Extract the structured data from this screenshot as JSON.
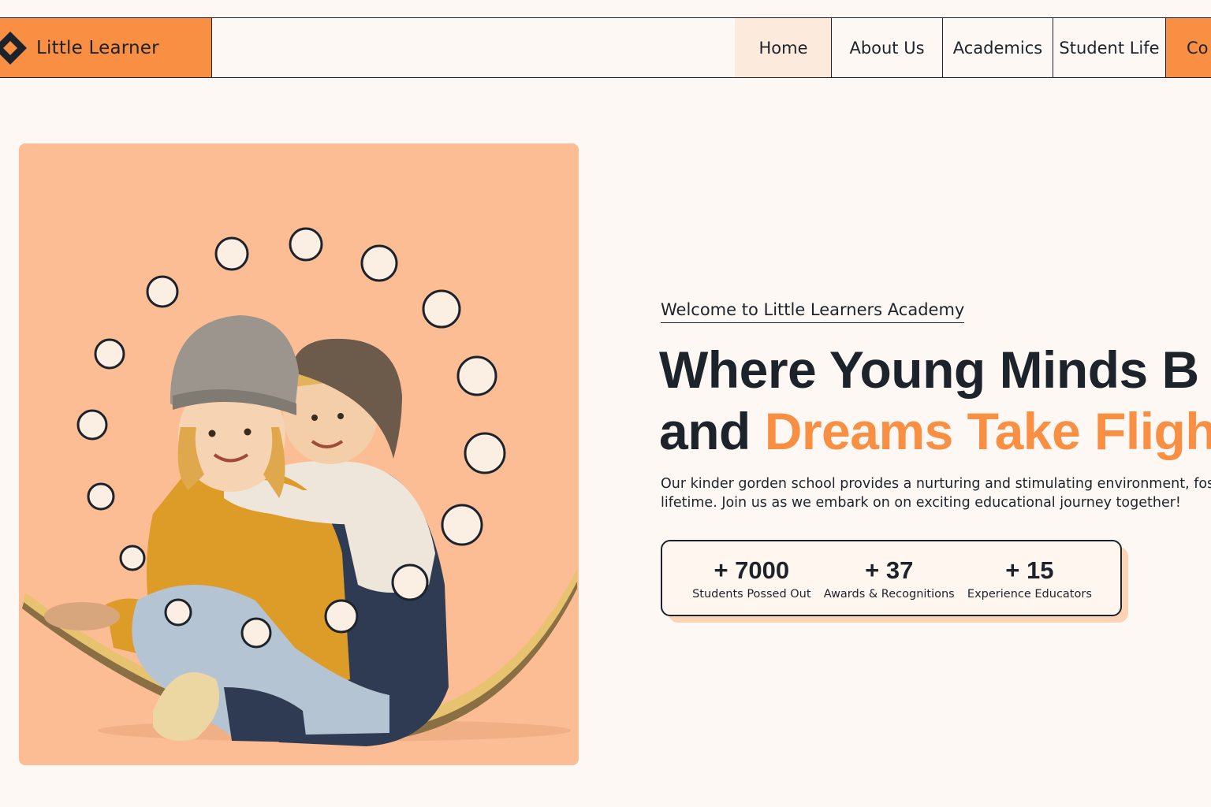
{
  "brand": {
    "name": "Little Learner",
    "logo_icon": "diamond-logo-icon",
    "accent_color": "#f98f42",
    "dark_color": "#1d232b",
    "background_color": "#fdf8f3"
  },
  "nav": {
    "items": [
      {
        "label": "Home",
        "active": true
      },
      {
        "label": "About Us",
        "active": false
      },
      {
        "label": "Academics",
        "active": false
      },
      {
        "label": "Student Life",
        "active": false
      }
    ],
    "cta_label": "Co"
  },
  "hero": {
    "eyebrow": "Welcome to Little Learners Academy",
    "headline_line1": "Where Young Minds B",
    "headline_line2_plain": "and ",
    "headline_line2_accent": "Dreams Take Fligh",
    "description_line1": "Our kinder gorden school provides a nurturing and stimulating environment, fostering",
    "description_line2": "lifetime. Join us as we embark on on exciting educational journey together!",
    "image_bg_color": "#fcbc94"
  },
  "stats": [
    {
      "value": "+ 7000",
      "label": "Students Possed Out"
    },
    {
      "value": "+ 37",
      "label": "Awards & Recognitions"
    },
    {
      "value": "+ 15",
      "label": "Experience Educators"
    }
  ]
}
